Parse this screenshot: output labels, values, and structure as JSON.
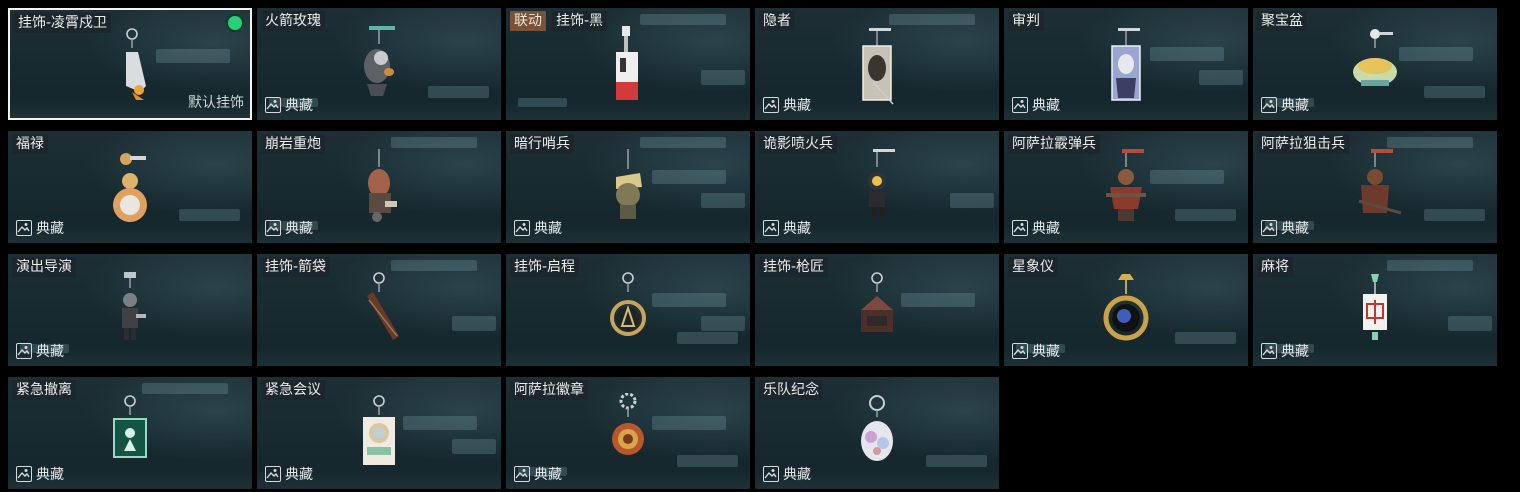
{
  "page": {
    "default_label": "默认挂饰",
    "collection_label": "典藏",
    "collab_tag": "联动",
    "accent_color": "#26d07a"
  },
  "items": [
    {
      "name": "挂饰-凌霄戍卫",
      "selected": true,
      "status": "equipped",
      "collection": false,
      "default": true,
      "icon": "rocket-charm-icon"
    },
    {
      "name": "火箭玫瑰",
      "collection": true,
      "icon": "rocket-rose-charm-icon"
    },
    {
      "name": "挂饰-黑",
      "collab": true,
      "collection": false,
      "icon": "black-tag-charm-icon"
    },
    {
      "name": "隐者",
      "collection": true,
      "icon": "hermit-card-charm-icon"
    },
    {
      "name": "审判",
      "collection": true,
      "icon": "judgement-card-charm-icon"
    },
    {
      "name": "聚宝盆",
      "collection": true,
      "icon": "treasure-bowl-charm-icon"
    },
    {
      "name": "福禄",
      "collection": true,
      "icon": "gourd-charm-icon"
    },
    {
      "name": "崩岩重炮",
      "collection": true,
      "icon": "heavy-cannon-charm-icon"
    },
    {
      "name": "暗行哨兵",
      "collection": true,
      "icon": "sentinel-charm-icon"
    },
    {
      "name": "诡影喷火兵",
      "collection": true,
      "icon": "flamethrower-charm-icon"
    },
    {
      "name": "阿萨拉霰弹兵",
      "collection": true,
      "icon": "shotgunner-charm-icon"
    },
    {
      "name": "阿萨拉狙击兵",
      "collection": true,
      "icon": "sniper-charm-icon"
    },
    {
      "name": "演出导演",
      "collection": true,
      "icon": "director-charm-icon"
    },
    {
      "name": "挂饰-箭袋",
      "collection": false,
      "icon": "quiver-charm-icon"
    },
    {
      "name": "挂饰-启程",
      "collection": false,
      "icon": "departure-medal-charm-icon"
    },
    {
      "name": "挂饰-枪匠",
      "collection": false,
      "icon": "gunsmith-charm-icon"
    },
    {
      "name": "星象仪",
      "collection": true,
      "icon": "astrolabe-charm-icon"
    },
    {
      "name": "麻将",
      "collection": true,
      "icon": "mahjong-tile-charm-icon"
    },
    {
      "name": "紧急撤离",
      "collection": true,
      "icon": "evacuation-sign-charm-icon"
    },
    {
      "name": "紧急会议",
      "collection": true,
      "icon": "meeting-charm-icon"
    },
    {
      "name": "阿萨拉徽章",
      "collection": true,
      "icon": "emblem-charm-icon"
    },
    {
      "name": "乐队纪念",
      "collection": true,
      "icon": "band-badge-charm-icon"
    }
  ]
}
